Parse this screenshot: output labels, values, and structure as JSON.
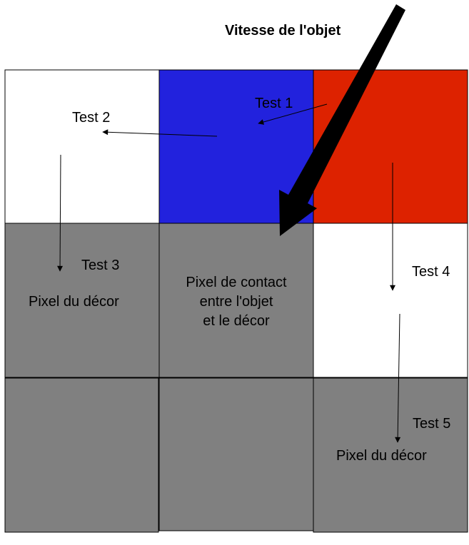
{
  "title": "Vitesse de l'objet",
  "colors": {
    "blue": "#2222dd",
    "red": "#dd2200",
    "white": "#ffffff",
    "gray": "#808080",
    "line": "#000000"
  },
  "cells": [
    {
      "id": "r0c0",
      "color": "white"
    },
    {
      "id": "r0c1",
      "color": "blue"
    },
    {
      "id": "r0c2",
      "color": "red"
    },
    {
      "id": "r1c0",
      "color": "gray"
    },
    {
      "id": "r1c1",
      "color": "gray"
    },
    {
      "id": "r1c2",
      "color": "white"
    },
    {
      "id": "r2c0",
      "color": "gray"
    },
    {
      "id": "r2c1",
      "color": "gray"
    },
    {
      "id": "r2c2",
      "color": "gray"
    }
  ],
  "labels": {
    "test1": "Test 1",
    "test2": "Test 2",
    "test3": "Test 3",
    "test4": "Test 4",
    "test5": "Test 5",
    "decor_left": "Pixel du décor",
    "contact_line1": "Pixel de contact",
    "contact_line2": "entre l'objet",
    "contact_line3": "et le décor",
    "decor_right": "Pixel du décor"
  }
}
